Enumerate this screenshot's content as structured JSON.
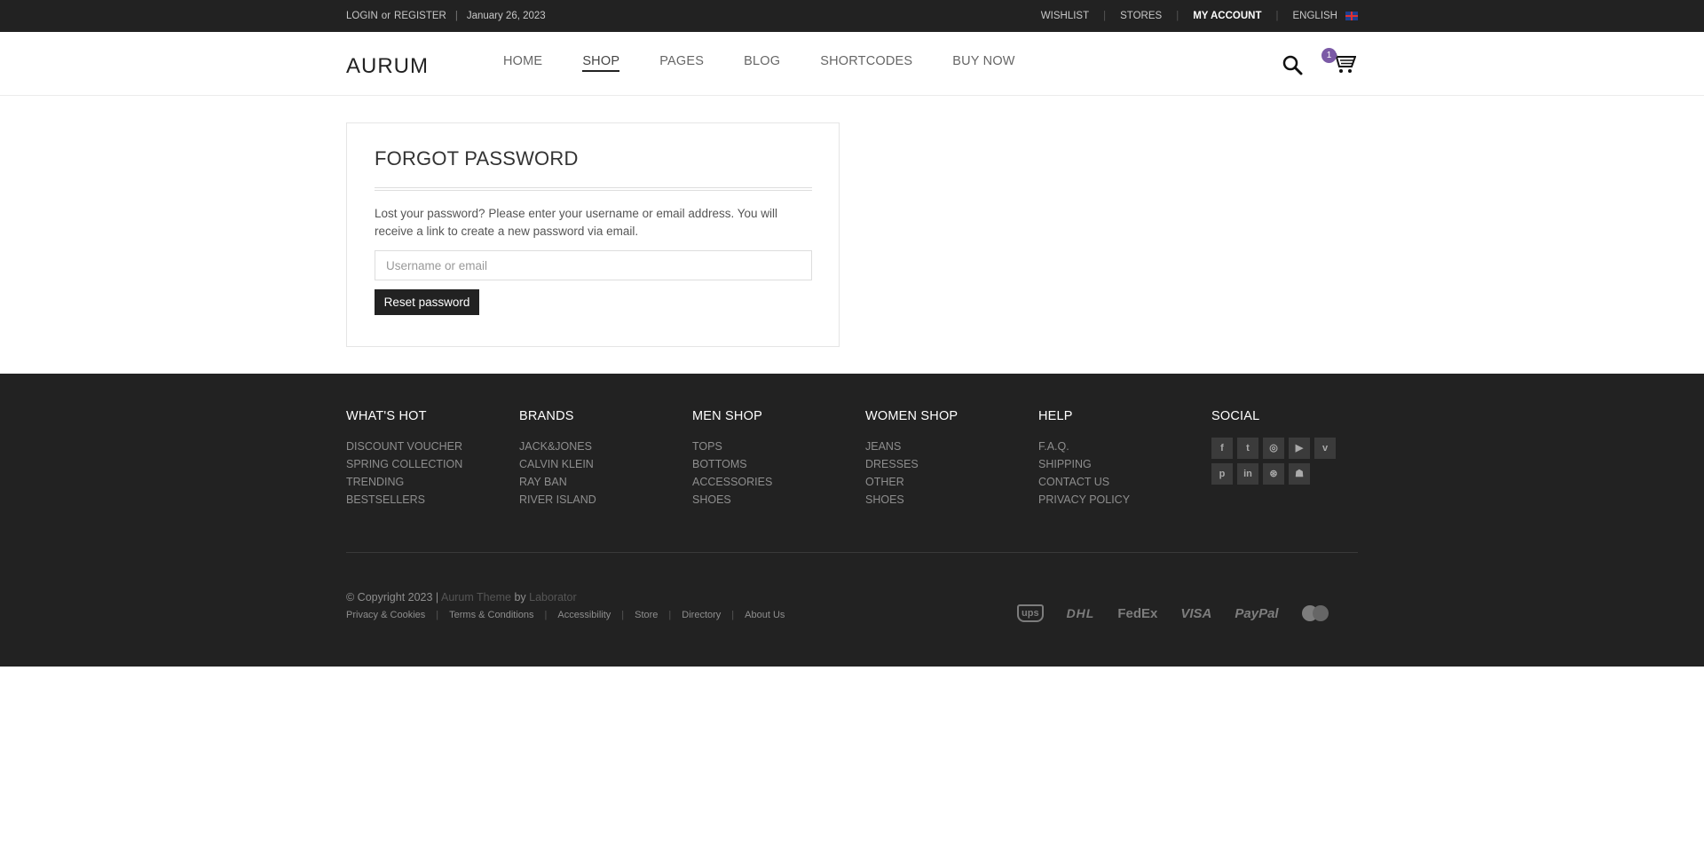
{
  "topbar": {
    "login": "LOGIN",
    "or": "or",
    "register": "REGISTER",
    "separator": "|",
    "date": "January 26, 2023",
    "wishlist": "WISHLIST",
    "stores": "STORES",
    "my_account": "MY ACCOUNT",
    "language": "ENGLISH",
    "right_sep": "|"
  },
  "header": {
    "logo": "AURUM",
    "nav": [
      "HOME",
      "SHOP",
      "PAGES",
      "BLOG",
      "SHORTCODES",
      "BUY NOW"
    ],
    "cart_count": "1"
  },
  "forgot": {
    "title": "FORGOT PASSWORD",
    "description": "Lost your password? Please enter your username or email address. You will receive a link to create a new password via email.",
    "input_placeholder": "Username or email",
    "button": "Reset password"
  },
  "footer": {
    "columns": [
      {
        "title": "WHAT'S HOT",
        "items": [
          "DISCOUNT VOUCHER",
          "SPRING COLLECTION",
          "TRENDING",
          "BESTSELLERS"
        ]
      },
      {
        "title": "BRANDS",
        "items": [
          "JACK&JONES",
          "CALVIN KLEIN",
          "RAY BAN",
          "RIVER ISLAND"
        ]
      },
      {
        "title": "MEN SHOP",
        "items": [
          "TOPS",
          "BOTTOMS",
          "ACCESSORIES",
          "SHOES"
        ]
      },
      {
        "title": "WOMEN SHOP",
        "items": [
          "JEANS",
          "DRESSES",
          "OTHER",
          "SHOES"
        ]
      },
      {
        "title": "HELP",
        "items": [
          "F.A.Q.",
          "SHIPPING",
          "CONTACT US",
          "PRIVACY POLICY"
        ]
      }
    ],
    "social_title": "SOCIAL",
    "social_icons": [
      "facebook-icon",
      "twitter-icon",
      "instagram-icon",
      "youtube-icon",
      "vimeo-icon",
      "pinterest-icon",
      "linkedin-icon",
      "dribbble-icon",
      "snapchat-icon"
    ],
    "social_glyphs": [
      "f",
      "t",
      "◎",
      "▶",
      "v",
      "p",
      "in",
      "⊛",
      "☗"
    ],
    "copyright_prefix": "© Copyright 2023 |",
    "theme": "Aurum Theme",
    "by": "by",
    "author": "Laborator",
    "links": [
      "Privacy & Cookies",
      "Terms & Conditions",
      "Accessibility",
      "Store",
      "Directory",
      "About Us"
    ],
    "link_sep": "|",
    "payments": [
      "ups",
      "DHL",
      "FedEx",
      "VISA",
      "PayPal",
      "mastercard"
    ]
  }
}
